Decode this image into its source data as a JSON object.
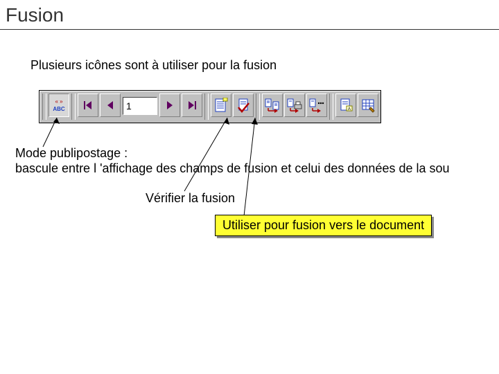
{
  "title": "Fusion",
  "intro": "Plusieurs icônes sont à utiliser pour la fusion",
  "mode_text": "Mode publipostage :\nbascule entre l 'affichage des champs de fusion et celui des données de la sou",
  "verify_text": "Vérifier la fusion",
  "callout": "Utiliser pour fusion vers le document",
  "toolbar": {
    "record_value": "1",
    "icons": {
      "abc_toggle": "abc-toggle-icon",
      "first": "first-record-icon",
      "prev": "prev-record-icon",
      "next": "next-record-icon",
      "last": "last-record-icon",
      "source": "mail-merge-source-icon",
      "check": "check-merge-icon",
      "to_doc": "merge-to-doc-icon",
      "to_print": "merge-to-printer-icon",
      "to_other": "merge-options-icon",
      "find": "find-record-icon",
      "edit_source": "edit-data-source-icon"
    }
  },
  "colors": {
    "callout_bg": "#ffff33",
    "toolbar_bg": "#c0c0c0",
    "red": "#b00000",
    "blue": "#2040c0"
  }
}
